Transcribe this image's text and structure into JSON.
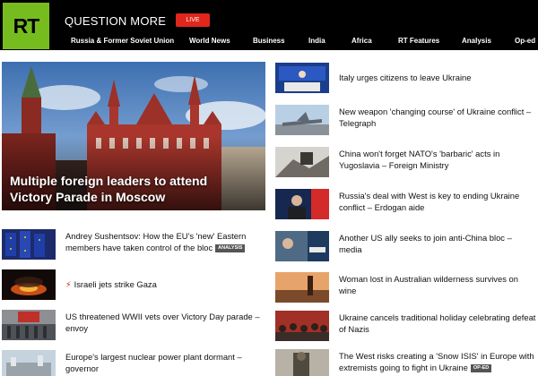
{
  "header": {
    "logo_text": "RT",
    "tagline": "QUESTION MORE",
    "live_label": "LIVE",
    "nav": [
      "Russia & Former Soviet Union",
      "World News",
      "Business",
      "India",
      "Africa",
      "RT Features",
      "Analysis",
      "Op-ed"
    ]
  },
  "hero": {
    "title": "Multiple foreign leaders to attend Victory Parade in Moscow"
  },
  "left_list": [
    {
      "title": "Andrey Sushentsov: How the EU's 'new' Eastern members have taken control of the bloc",
      "badge": "ANALYSIS"
    },
    {
      "title": "Israeli jets strike Gaza",
      "icon": "lightning-icon"
    },
    {
      "title": "US threatened WWII vets over Victory Day parade – envoy"
    },
    {
      "title": "Europe's largest nuclear power plant dormant – governor"
    }
  ],
  "right_list": [
    {
      "title": "Italy urges citizens to leave Ukraine"
    },
    {
      "title": "New weapon 'changing course' of Ukraine conflict – Telegraph"
    },
    {
      "title": "China won't forget NATO's 'barbaric' acts in Yugoslavia – Foreign Ministry"
    },
    {
      "title": "Russia's deal with West is key to ending Ukraine conflict – Erdogan aide"
    },
    {
      "title": "Another US ally seeks to join anti-China bloc – media"
    },
    {
      "title": "Woman lost in Australian wilderness survives on wine"
    },
    {
      "title": "Ukraine cancels traditional holiday celebrating defeat of Nazis"
    },
    {
      "title": "The West risks creating a 'Snow ISIS' in Europe with extremists going to fight in Ukraine",
      "badge": "OP-ED"
    }
  ],
  "colors": {
    "brand_green": "#77bc1f",
    "live_red": "#e1261c",
    "header_bg": "#000000",
    "badge_gray": "#555555"
  }
}
